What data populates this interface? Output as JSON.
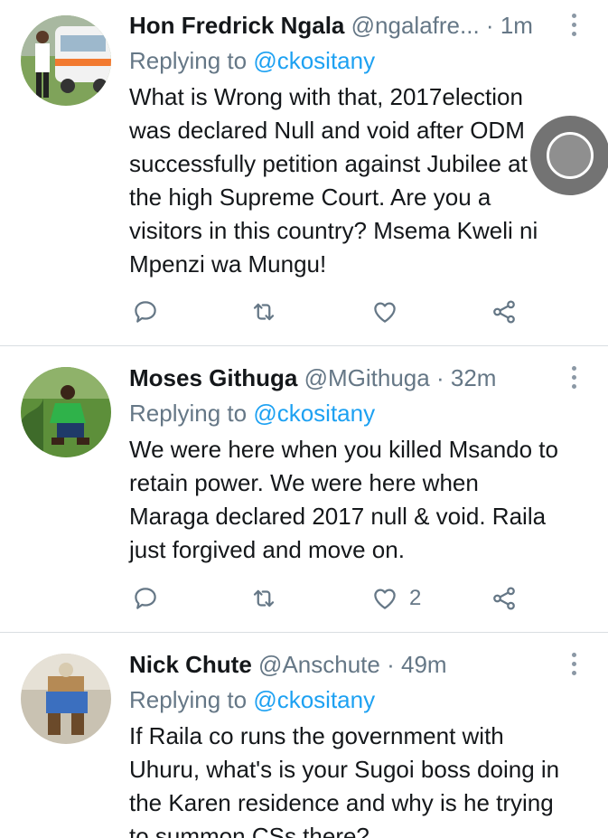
{
  "tweets": [
    {
      "name": "Hon Fredrick Ngala",
      "handle": "@ngalafre...",
      "dot": "·",
      "time": "1m",
      "replying_prefix": "Replying to",
      "replying_to": "@ckositany",
      "lines": [
        "What is Wrong with that, 2017election",
        "was declared Null and void after ODM",
        "successfully petition against Jubilee at",
        "the high Supreme Court. Are you a",
        "visitors in this country? Msema Kweli ni",
        "Mpenzi wa Mungu!"
      ],
      "like_count": ""
    },
    {
      "name": "Moses Githuga",
      "handle": "@MGithuga",
      "dot": "·",
      "time": "32m",
      "replying_prefix": "Replying to",
      "replying_to": "@ckositany",
      "lines": [
        "We were here when you killed Msando to",
        "retain power. We were here when",
        "Maraga declared 2017 null & void. Raila",
        "just forgived and move on."
      ],
      "like_count": "2"
    },
    {
      "name": "Nick Chute",
      "handle": "@Anschute",
      "dot": "·",
      "time": "49m",
      "replying_prefix": "Replying to",
      "replying_to": "@ckositany",
      "lines": [
        "If Raila co runs the government with",
        "Uhuru, what's is your Sugoi boss doing in",
        "the Karen residence and why is he trying",
        "to summon CSs there?"
      ]
    }
  ],
  "colors": {
    "accent": "#1da1f2",
    "secondary_text": "#657786",
    "icon": "#657786",
    "divider": "#d9dee2"
  },
  "icons": [
    "reply-icon",
    "retweet-icon",
    "like-icon",
    "share-icon",
    "more-options-icon"
  ]
}
